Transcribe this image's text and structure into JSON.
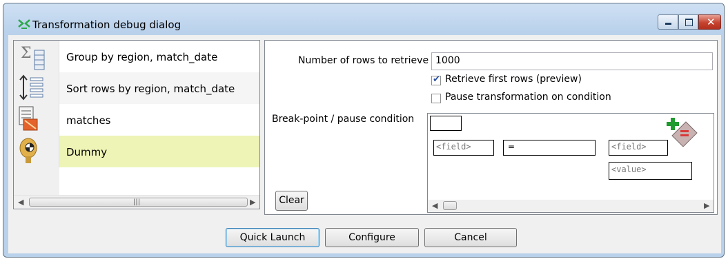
{
  "window": {
    "title": "Transformation debug dialog",
    "controls": {
      "minimize": "minimize-icon",
      "maximize": "maximize-icon",
      "close": "close-icon"
    }
  },
  "steps": [
    {
      "label": "Group by region, match_date",
      "icon": "group-by-icon",
      "state": "normal"
    },
    {
      "label": "Sort rows by region, match_date",
      "icon": "sort-rows-icon",
      "state": "selected"
    },
    {
      "label": "matches",
      "icon": "table-input-icon",
      "state": "normal"
    },
    {
      "label": "Dummy",
      "icon": "dummy-icon",
      "state": "highlighted"
    }
  ],
  "options": {
    "rows_label": "Number of rows to retrieve",
    "rows_value": "1000",
    "retrieve_first_label": "Retrieve first rows (preview)",
    "retrieve_first_checked": true,
    "pause_label": "Pause transformation on condition",
    "pause_checked": false,
    "breakpoint_label": "Break-point / pause condition",
    "condition": {
      "left_field": "<field>",
      "operator": "=",
      "right_field": "<field>",
      "value": "<value>"
    },
    "clear_label": "Clear"
  },
  "buttons": {
    "quick_launch": "Quick Launch",
    "configure": "Configure",
    "cancel": "Cancel"
  },
  "colors": {
    "title_bar": "#bad2ec",
    "highlight_row": "#eef4b5",
    "close_button": "#c6432f"
  }
}
